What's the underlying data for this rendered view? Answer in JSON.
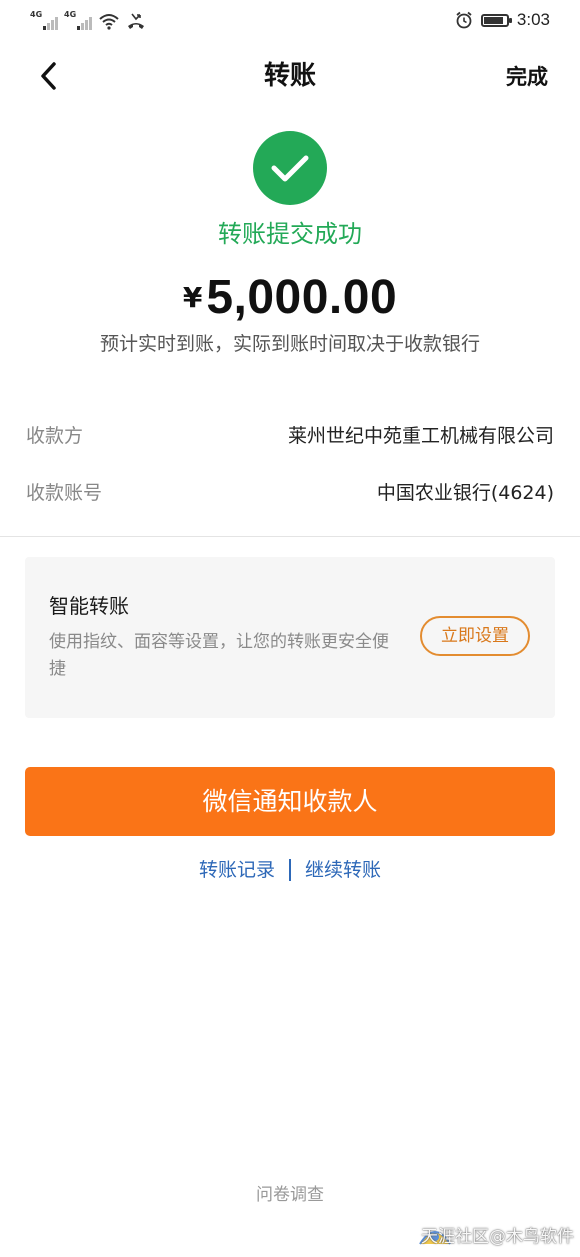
{
  "status_bar": {
    "sim1_label": "4G",
    "sim2_label": "4G",
    "battery_level": 0.85,
    "time": "3:03"
  },
  "nav": {
    "title": "转账",
    "done_label": "完成"
  },
  "result": {
    "status_text": "转账提交成功",
    "currency_symbol": "¥",
    "amount": "5,000.00",
    "note": "预计实时到账，实际到账时间取决于收款银行"
  },
  "details": {
    "payee_label": "收款方",
    "payee_value": "莱州世纪中苑重工机械有限公司",
    "account_label": "收款账号",
    "account_value": "中国农业银行(4624)"
  },
  "smart_transfer": {
    "title": "智能转账",
    "description": "使用指纹、面容等设置，让您的转账更安全便捷",
    "button_label": "立即设置"
  },
  "actions": {
    "notify_button": "微信通知收款人",
    "records_link": "转账记录",
    "continue_link": "继续转账"
  },
  "footer": {
    "survey_label": "问卷调查",
    "watermark": "天涯社区@木鸟软件"
  },
  "colors": {
    "success_green": "#23a957",
    "primary_orange": "#fa7417",
    "link_blue": "#2d68b8"
  }
}
